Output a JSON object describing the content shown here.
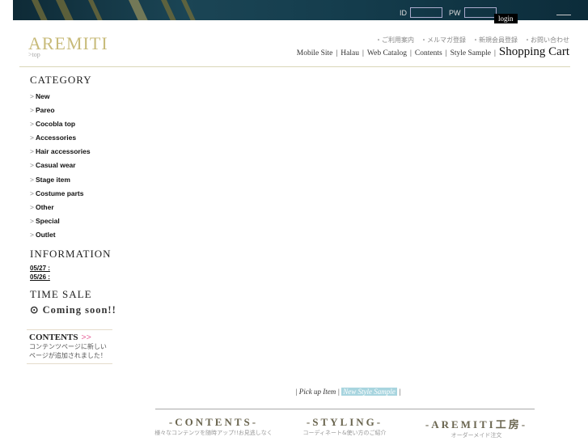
{
  "header": {
    "id_label": "ID",
    "pw_label": "PW",
    "login": "login"
  },
  "logo": {
    "text": "AREMITI",
    "sub": ">top"
  },
  "sublinks": [
    "・ご利用案内",
    "・メルマガ登録",
    "・新規会員登録",
    "・お問い合わせ"
  ],
  "nav": [
    "Mobile Site",
    "Halau",
    "Web Catalog",
    "Contents",
    "Style Sample"
  ],
  "nav_cart": "Shopping Cart",
  "sidebar": {
    "category_title": "CATEGORY",
    "categories": [
      "New",
      "Pareo",
      "Cocobla top",
      "Accessories",
      "Hair accessories",
      "Casual wear",
      "Stage item",
      "Costume parts",
      "Other",
      "Special",
      "Outlet"
    ],
    "information_title": "INFORMATION",
    "info": [
      "05/27 :",
      "05/26 :"
    ],
    "timesale_title": "TIME SALE",
    "coming": "Coming soon!!",
    "contents_title": "CONTENTS",
    "contents_arrow": ">>",
    "contents_desc": "コンテンツページに新しいページが追加されました！"
  },
  "pickup": {
    "item": "Pick up Item",
    "sample": "New Style Sample"
  },
  "footer": [
    {
      "title": "-CONTENTS-",
      "sub": "様々なコンテンツを随時アップ!!お見逃しなく"
    },
    {
      "title": "-STYLING-",
      "sub": "コーディネート&使い方のご紹介"
    },
    {
      "title": "-AREMITI工房-",
      "sub": "オーダーメイド注文"
    }
  ]
}
